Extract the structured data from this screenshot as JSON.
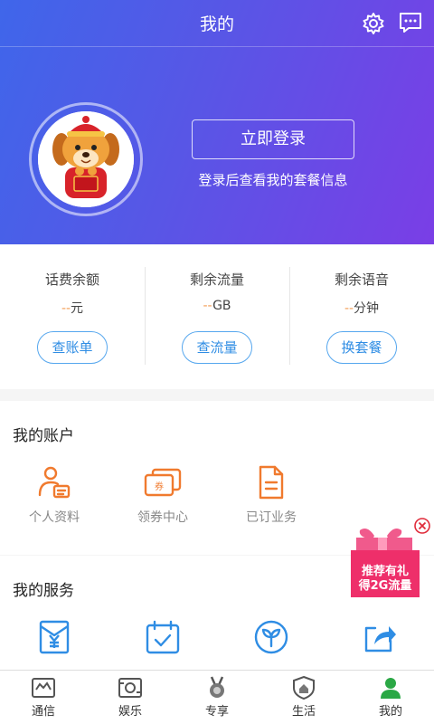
{
  "header": {
    "title": "我的",
    "settings_icon": "gear-icon",
    "message_icon": "message-icon"
  },
  "profile": {
    "login_button": "立即登录",
    "login_hint": "登录后查看我的套餐信息",
    "avatar_icon": "cartoon-dog-avatar"
  },
  "stats": [
    {
      "label": "话费余额",
      "value_dash": "--",
      "unit": "元",
      "button": "查账单"
    },
    {
      "label": "剩余流量",
      "value_dash": "--",
      "unit": "GB",
      "button": "查流量"
    },
    {
      "label": "剩余语音",
      "value_dash": "--",
      "unit": "分钟",
      "button": "换套餐"
    }
  ],
  "account": {
    "title": "我的账户",
    "items": [
      {
        "label": "个人资料",
        "icon": "profile-card-icon"
      },
      {
        "label": "领券中心",
        "icon": "coupon-icon"
      },
      {
        "label": "已订业务",
        "icon": "document-icon"
      }
    ]
  },
  "services": {
    "title": "我的服务",
    "items": [
      {
        "icon": "yuan-envelope-icon"
      },
      {
        "icon": "calendar-check-icon"
      },
      {
        "icon": "sprout-icon"
      },
      {
        "icon": "share-icon"
      }
    ]
  },
  "promo": {
    "line1": "推荐有礼",
    "line2": "得2G流量"
  },
  "tabs": [
    {
      "label": "通信",
      "icon": "communication-icon"
    },
    {
      "label": "娱乐",
      "icon": "entertainment-icon"
    },
    {
      "label": "专享",
      "icon": "medal-icon"
    },
    {
      "label": "生活",
      "icon": "life-shield-icon"
    },
    {
      "label": "我的",
      "icon": "user-icon",
      "active": true
    }
  ],
  "colors": {
    "accent_blue": "#2f8de4",
    "orange": "#f07a2e",
    "active_tab_green": "#2aa845"
  }
}
